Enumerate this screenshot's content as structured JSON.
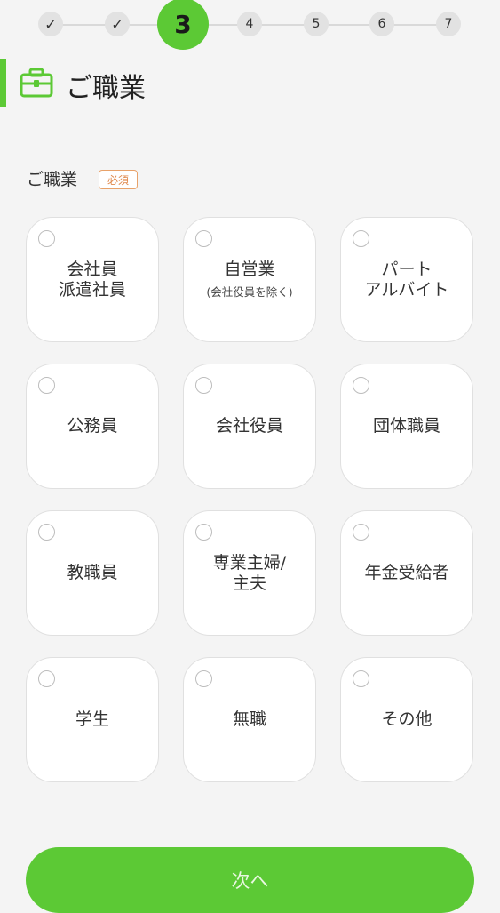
{
  "stepper": {
    "steps": [
      {
        "label": "✓",
        "state": "done"
      },
      {
        "label": "✓",
        "state": "done"
      },
      {
        "label": "3",
        "state": "current"
      },
      {
        "label": "4",
        "state": "upcoming"
      },
      {
        "label": "5",
        "state": "upcoming"
      },
      {
        "label": "6",
        "state": "upcoming"
      },
      {
        "label": "7",
        "state": "upcoming"
      }
    ]
  },
  "header": {
    "title": "ご職業",
    "icon": "briefcase-icon"
  },
  "section": {
    "label": "ご職業",
    "required_badge": "必須"
  },
  "options": [
    {
      "label": "会社員\n派遣社員",
      "sublabel": ""
    },
    {
      "label": "自営業",
      "sublabel": "(会社役員を除く)"
    },
    {
      "label": "パート\nアルバイト",
      "sublabel": ""
    },
    {
      "label": "公務員",
      "sublabel": ""
    },
    {
      "label": "会社役員",
      "sublabel": ""
    },
    {
      "label": "団体職員",
      "sublabel": ""
    },
    {
      "label": "教職員",
      "sublabel": ""
    },
    {
      "label": "専業主婦/\n主夫",
      "sublabel": ""
    },
    {
      "label": "年金受給者",
      "sublabel": ""
    },
    {
      "label": "学生",
      "sublabel": ""
    },
    {
      "label": "無職",
      "sublabel": ""
    },
    {
      "label": "その他",
      "sublabel": ""
    }
  ],
  "next_button": {
    "label": "次へ"
  },
  "colors": {
    "accent": "#5cc935",
    "badge": "#e08a4e",
    "background": "#f4f4f4"
  }
}
